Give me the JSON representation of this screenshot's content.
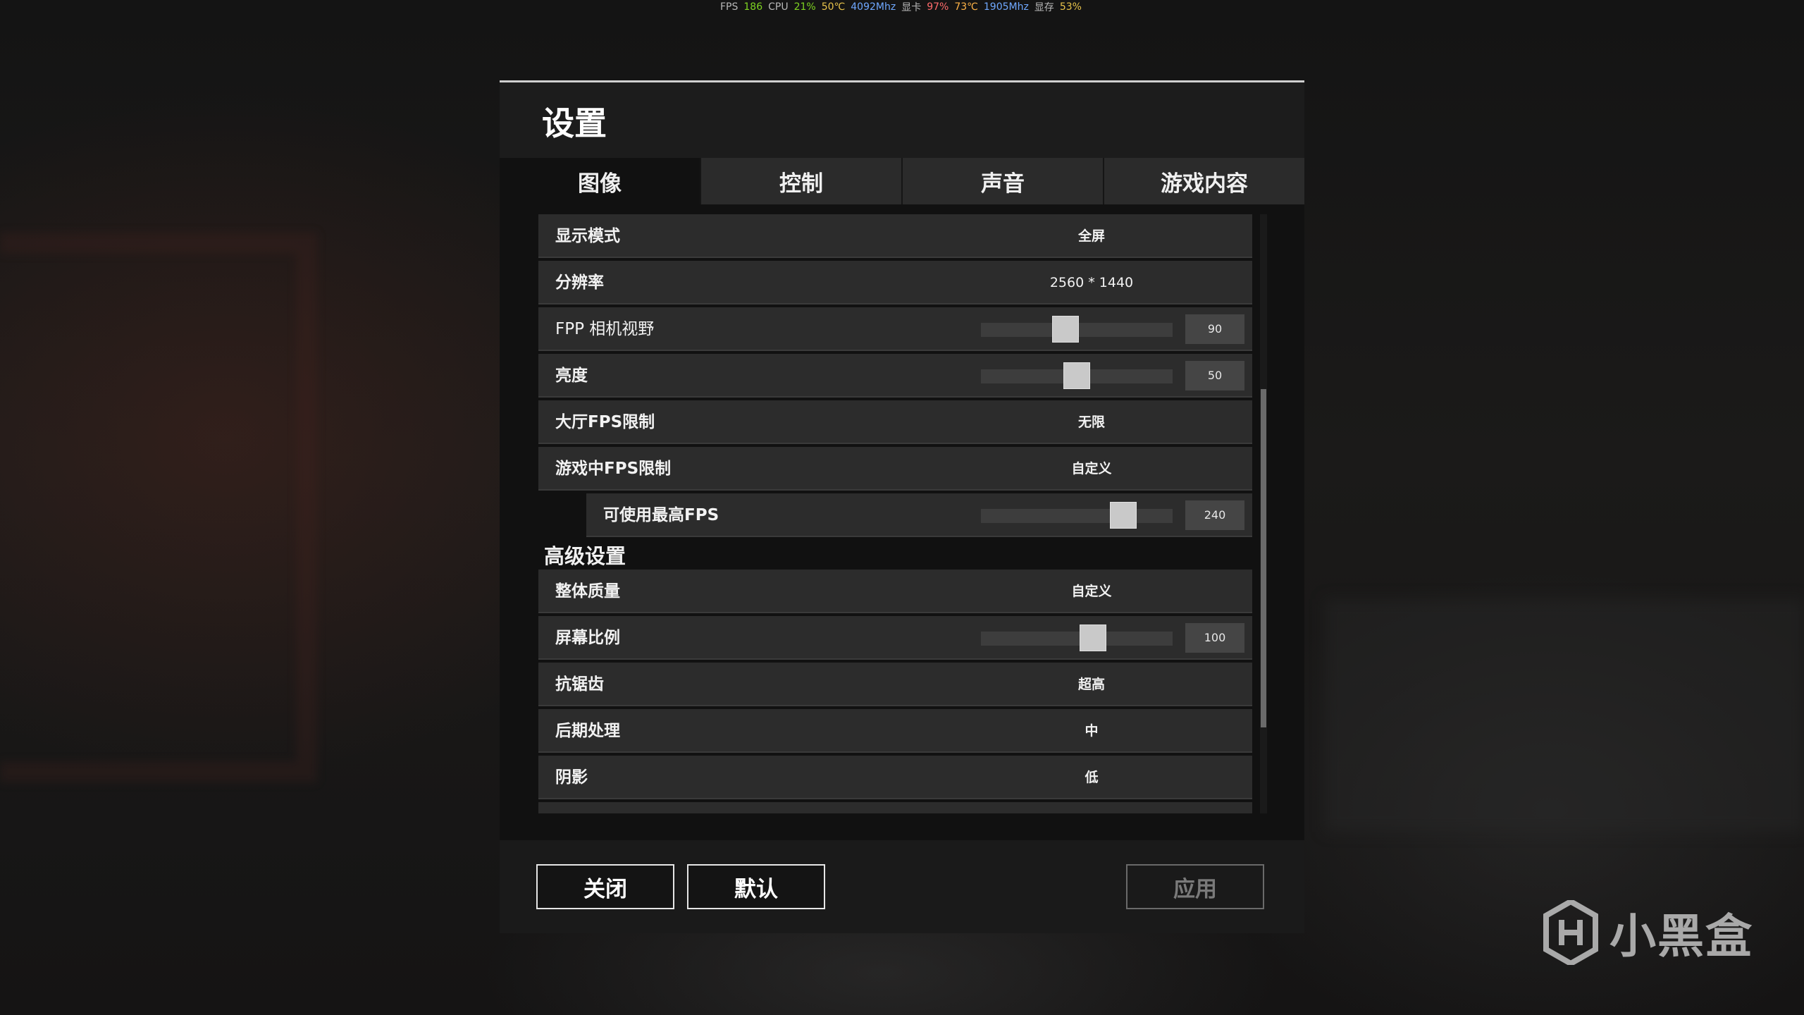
{
  "overlay": [
    {
      "text": "FPS",
      "color": "k"
    },
    {
      "text": "186",
      "color": "green"
    },
    {
      "text": "CPU",
      "color": "k"
    },
    {
      "text": "21%",
      "color": "green"
    },
    {
      "text": "50℃",
      "color": "yellow"
    },
    {
      "text": "4092Mhz",
      "color": "blue"
    },
    {
      "text": "显卡",
      "color": "k"
    },
    {
      "text": "97%",
      "color": "red"
    },
    {
      "text": "73℃",
      "color": "orange"
    },
    {
      "text": "1905Mhz",
      "color": "blue"
    },
    {
      "text": "显存",
      "color": "k"
    },
    {
      "text": "53%",
      "color": "yellow"
    }
  ],
  "dialog": {
    "title": "设置",
    "tabs": [
      {
        "label": "图像",
        "active": true
      },
      {
        "label": "控制",
        "active": false
      },
      {
        "label": "声音",
        "active": false
      },
      {
        "label": "游戏内容",
        "active": false
      }
    ],
    "settings": [
      {
        "label": "显示模式",
        "value": "全屏"
      },
      {
        "label": "分辨率",
        "value": "2560 * 1440"
      },
      {
        "label": "FPP 相机视野",
        "slider": 90,
        "level": 0.43
      },
      {
        "label": "亮度",
        "slider": 50,
        "level": 0.5
      },
      {
        "label": "大厅FPS限制",
        "value": "无限"
      },
      {
        "label": "游戏中FPS限制",
        "value": "自定义"
      },
      {
        "label": "可使用最高FPS",
        "slider": 240,
        "level": 0.78
      }
    ],
    "section_header": "高级设置",
    "advanced_settings": [
      {
        "label": "整体质量",
        "value": "自定义"
      },
      {
        "label": "屏幕比例",
        "slider": 100,
        "level": 0.6
      },
      {
        "label": "抗锯齿",
        "value": "超高"
      },
      {
        "label": "后期处理",
        "value": "中"
      },
      {
        "label": "阴影",
        "value": "低"
      }
    ],
    "buttons": {
      "close": "关闭",
      "default": "默认",
      "apply": "应用"
    }
  },
  "watermark": {
    "text": "小黑盒",
    "icon": "xiaoheihe-logo-icon"
  }
}
